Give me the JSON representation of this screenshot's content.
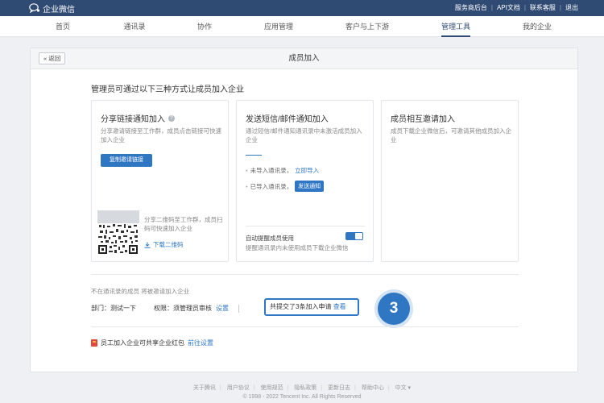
{
  "topbar": {
    "logo_text": "企业微信",
    "links": [
      "服务商后台",
      "API文档",
      "联系客服",
      "退出"
    ]
  },
  "nav": {
    "tabs": [
      "首页",
      "通讯录",
      "协作",
      "应用管理",
      "客户与上下游",
      "管理工具",
      "我的企业"
    ],
    "active": "管理工具"
  },
  "card": {
    "back_label": "返回",
    "title": "成员加入",
    "intro": "管理员可通过以下三种方式让成员加入企业"
  },
  "share_link": {
    "title": "分享链接通知加入",
    "desc": "分享邀请链接至工作群，成员点击链接可快速加入企业",
    "copy_button": "复制邀请链接",
    "qr_desc": "分享二维码至工作群，成员扫码可快速加入企业",
    "download_label": "下载二维码"
  },
  "sms_email": {
    "title": "发送短信/邮件通知加入",
    "desc": "通过短信/邮件通知通讯录中未激活成员加入企业",
    "option1_text": "未导入通讯录，",
    "option1_link": "立即导入",
    "option2_text": "已导入通讯录，",
    "option2_button": "发送通知",
    "auto_remind_label": "自动提醒成员使用",
    "auto_remind_desc": "提醒通讯录内未使用成员下载企业微信",
    "auto_remind_on": true
  },
  "mutual_invite": {
    "title": "成员相互邀请加入",
    "desc": "成员下载企业微信后，可邀请其他成员加入企业"
  },
  "not_in_contacts": {
    "text": "不在通讯录的成员 将被邀请加入企业",
    "dept_label": "部门：",
    "dept_value": "测试一下",
    "permission_label": "权限：",
    "permission_value": "须管理员审核",
    "settings_link": "设置",
    "apply_text": "共提交了3条加入申请",
    "view_link": "查看"
  },
  "step_badge": "3",
  "red_packet": {
    "text": "员工加入企业可共享企业红包",
    "link": "前往设置"
  },
  "footer": {
    "links": [
      "关于腾讯",
      "用户协议",
      "使用规范",
      "隐私政策",
      "更新日志",
      "帮助中心",
      "中文 ▾"
    ],
    "copyright": "© 1998 - 2022 Tencent Inc. All Rights Reserved"
  },
  "colors": {
    "topbar": "#2f4a73",
    "primary": "#2f77c3",
    "background": "#eef0f3"
  }
}
